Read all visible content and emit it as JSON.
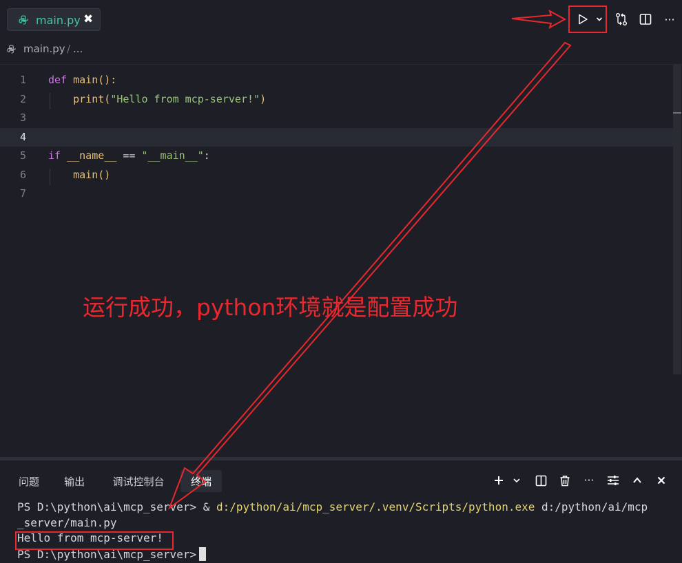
{
  "tab": {
    "filename": "main.py",
    "close": "✖"
  },
  "breadcrumb": {
    "file": "main.py",
    "separator": "/",
    "more": "..."
  },
  "toolbar": {
    "more": "···"
  },
  "editor": {
    "active_line": 4,
    "lines": [
      {
        "n": "1",
        "tokens": [
          {
            "t": "def ",
            "c": "kw"
          },
          {
            "t": "main",
            "c": "fn"
          },
          {
            "t": "():",
            "c": "par"
          }
        ]
      },
      {
        "n": "2",
        "tokens": [
          {
            "t": "    print",
            "c": "fn"
          },
          {
            "t": "(",
            "c": "par"
          },
          {
            "t": "\"Hello from mcp-server!\"",
            "c": "str"
          },
          {
            "t": ")",
            "c": "par"
          }
        ]
      },
      {
        "n": "3",
        "tokens": []
      },
      {
        "n": "4",
        "tokens": []
      },
      {
        "n": "5",
        "tokens": [
          {
            "t": "if ",
            "c": "kw"
          },
          {
            "t": "__name__",
            "c": "fn"
          },
          {
            "t": " == ",
            "c": "dim"
          },
          {
            "t": "\"__main__\"",
            "c": "str"
          },
          {
            "t": ":",
            "c": "dim"
          }
        ]
      },
      {
        "n": "6",
        "tokens": [
          {
            "t": "    main",
            "c": "fn"
          },
          {
            "t": "()",
            "c": "par"
          }
        ]
      },
      {
        "n": "7",
        "tokens": []
      }
    ]
  },
  "annotation": "运行成功，python环境就是配置成功",
  "panel": {
    "tabs": [
      {
        "label": "问题",
        "name": "panel-tab-problems"
      },
      {
        "label": "输出",
        "name": "panel-tab-output"
      },
      {
        "label": "调试控制台",
        "name": "panel-tab-debug-console"
      },
      {
        "label": "终端",
        "name": "panel-tab-terminal"
      }
    ],
    "active_tab": "终端"
  },
  "terminal": {
    "line1_prompt": "PS D:\\python\\ai\\mcp_server> & ",
    "line1_cmd": "d:/python/ai/mcp_server/.venv/Scripts/python.exe",
    "line1_rest": " d:/python/ai/mcp",
    "line2": "_server/main.py",
    "line3": "Hello from mcp-server!",
    "line4_prompt": "PS D:\\python\\ai\\mcp_server>"
  },
  "colors": {
    "accent": "#3ec9a0",
    "annotation_red": "#e8282e",
    "background": "#1e1f26"
  }
}
